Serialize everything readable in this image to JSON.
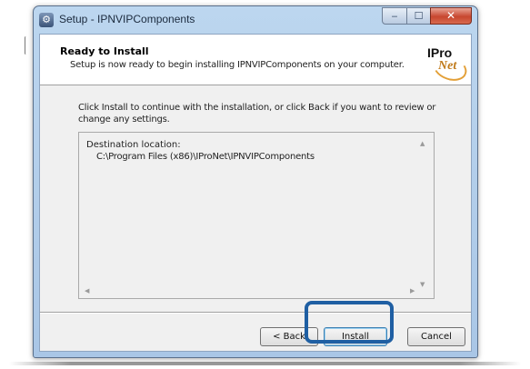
{
  "window": {
    "title": "Setup - IPNVIPComponents",
    "app_icon": "setup-icon",
    "controls": {
      "minimize": "‒",
      "maximize": "☐",
      "close": "✕"
    }
  },
  "header": {
    "title": "Ready to Install",
    "subtitle": "Setup is now ready to begin installing IPNVIPComponents on your computer.",
    "logo": {
      "text_top": "IPro",
      "text_bottom": "Net"
    }
  },
  "instructions": "Click Install to continue with the installation, or click Back if you want to review or change any settings.",
  "memo": {
    "label": "Destination location:",
    "path": "C:\\Program Files (x86)\\IProNet\\IPNVIPComponents"
  },
  "buttons": {
    "back": "< Back",
    "install": "Install",
    "cancel": "Cancel"
  },
  "colors": {
    "highlight": "#1f5fa3",
    "titlebar": "#bcd6ef",
    "close_button": "#c7462f"
  }
}
